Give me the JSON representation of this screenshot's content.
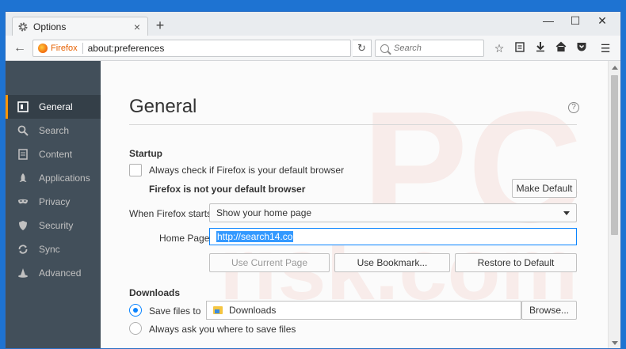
{
  "window": {
    "tab_title": "Options",
    "tab_close": "×",
    "new_tab": "+",
    "controls": [
      "—",
      "☐",
      "✕"
    ]
  },
  "navbar": {
    "identity_label": "Firefox",
    "url": "about:preferences",
    "search_placeholder": "Search"
  },
  "sidebar": {
    "items": [
      {
        "label": "General",
        "icon": "general-icon",
        "active": true
      },
      {
        "label": "Search",
        "icon": "search-icon"
      },
      {
        "label": "Content",
        "icon": "content-icon"
      },
      {
        "label": "Applications",
        "icon": "applications-icon"
      },
      {
        "label": "Privacy",
        "icon": "privacy-mask-icon"
      },
      {
        "label": "Security",
        "icon": "security-shield-icon"
      },
      {
        "label": "Sync",
        "icon": "sync-icon"
      },
      {
        "label": "Advanced",
        "icon": "advanced-wizard-hat-icon"
      }
    ]
  },
  "main": {
    "title": "General",
    "help": "?",
    "startup": {
      "heading": "Startup",
      "default_check_label": "Always check if Firefox is your default browser",
      "default_status": "Firefox is not your default browser",
      "make_default_button": "Make Default",
      "when_starts_label": "When Firefox starts:",
      "when_starts_value": "Show your home page",
      "home_page_label": "Home Page:",
      "home_page_value": "http://search14.co",
      "use_current_button": "Use Current Page",
      "use_bookmark_button": "Use Bookmark...",
      "restore_button": "Restore to Default"
    },
    "downloads": {
      "heading": "Downloads",
      "save_files_label": "Save files to",
      "folder": "Downloads",
      "browse_button": "Browse...",
      "always_ask_label": "Always ask you where to save files"
    }
  },
  "colors": {
    "sidebar_bg": "#424f5a",
    "sidebar_active": "#343f48",
    "accent": "#ff9500",
    "focus_blue": "#0a84ff",
    "desktop_blue": "#1e73d2"
  }
}
